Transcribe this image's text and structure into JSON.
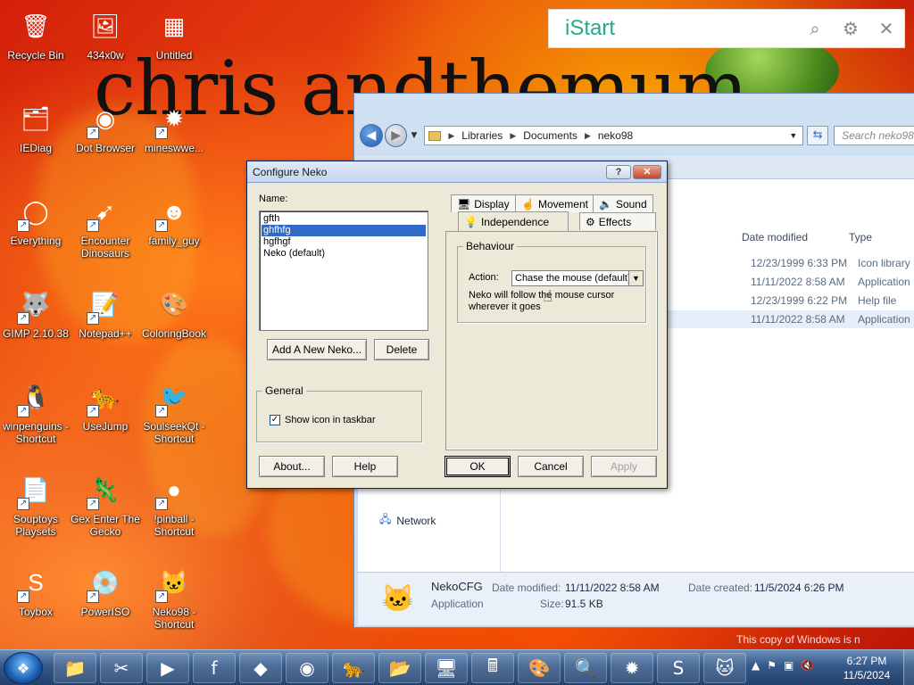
{
  "wallpaper": {
    "text": "chris andthemum"
  },
  "desktop": {
    "icons": [
      {
        "label": "Recycle Bin",
        "glyph": "🗑",
        "shortcut": false
      },
      {
        "label": "434x0w",
        "glyph": "🖼",
        "shortcut": false
      },
      {
        "label": "Untitled",
        "glyph": "▦",
        "shortcut": false
      },
      {
        "label": "IEDiag",
        "glyph": "🗂",
        "shortcut": false
      },
      {
        "label": "Dot Browser",
        "glyph": "◉",
        "shortcut": true
      },
      {
        "label": "mineswwe...",
        "glyph": "✹",
        "shortcut": true
      },
      {
        "label": "Everything",
        "glyph": "◯",
        "shortcut": true
      },
      {
        "label": "Encounter Dinosaurs",
        "glyph": "➹",
        "shortcut": true
      },
      {
        "label": "family_guy",
        "glyph": "☻",
        "shortcut": true
      },
      {
        "label": "GIMP 2.10.38",
        "glyph": "🐺",
        "shortcut": true
      },
      {
        "label": "Notepad++",
        "glyph": "📝",
        "shortcut": true
      },
      {
        "label": "ColoringBook",
        "glyph": "🎨",
        "shortcut": false
      },
      {
        "label": "winpenguins - Shortcut",
        "glyph": "🐧",
        "shortcut": true
      },
      {
        "label": "UseJump",
        "glyph": "🐆",
        "shortcut": true
      },
      {
        "label": "SoulseekQt - Shortcut",
        "glyph": "🐦",
        "shortcut": true
      },
      {
        "label": "Souptoys Playsets",
        "glyph": "📄",
        "shortcut": true
      },
      {
        "label": "Gex Enter The Gecko",
        "glyph": "🦎",
        "shortcut": true
      },
      {
        "label": "!pinball - Shortcut",
        "glyph": "●",
        "shortcut": true
      },
      {
        "label": "Toybox",
        "glyph": "S",
        "shortcut": true
      },
      {
        "label": "PowerISO",
        "glyph": "💿",
        "shortcut": true
      },
      {
        "label": "Neko98 - Shortcut",
        "glyph": "🐱",
        "shortcut": true
      }
    ]
  },
  "istart": {
    "brand": "iStart",
    "search_icon": "search-icon",
    "settings_icon": "gear-icon",
    "close_icon": "close-icon"
  },
  "explorer": {
    "breadcrumb": [
      "Libraries",
      "Documents",
      "neko98"
    ],
    "search_placeholder": "Search neko98",
    "columns": [
      "Date modified",
      "Type"
    ],
    "files": [
      {
        "date": "12/23/1999 6:33 PM",
        "type": "Icon library",
        "selected": false
      },
      {
        "date": "11/11/2022 8:58 AM",
        "type": "Application",
        "selected": false
      },
      {
        "date": "12/23/1999 6:22 PM",
        "type": "Help file",
        "selected": false
      },
      {
        "date": "11/11/2022 8:58 AM",
        "type": "Application",
        "selected": true
      }
    ],
    "network_label": "Network",
    "details": {
      "name": "NekoCFG",
      "type": "Application",
      "modified_label": "Date modified:",
      "modified_value": "11/11/2022 8:58 AM",
      "created_label": "Date created:",
      "created_value": "11/5/2024 6:26 PM",
      "size_label": "Size:",
      "size_value": "91.5 KB"
    }
  },
  "dialog": {
    "title": "Configure Neko",
    "help_button": "?",
    "close_button": "✕",
    "name_label": "Name:",
    "names": [
      "gfth",
      "ghfhfg",
      "hgfhgf",
      "Neko (default)"
    ],
    "selected_name": "ghfhfg",
    "add_button": "Add A New Neko...",
    "delete_button": "Delete",
    "general_group": "General",
    "show_icon_label": "Show icon in taskbar",
    "show_icon_checked": true,
    "about_button": "About...",
    "help_btn_label": "Help",
    "tabs_row1": [
      {
        "label": "Display",
        "icon": "display-icon",
        "glyph": "🖥"
      },
      {
        "label": "Movement",
        "icon": "hand-icon",
        "glyph": "☝"
      },
      {
        "label": "Sound",
        "icon": "speaker-icon",
        "glyph": "🔈"
      }
    ],
    "tabs_row2": [
      {
        "label": "Independence",
        "icon": "bulb-icon",
        "glyph": "💡",
        "active": true
      },
      {
        "label": "Effects",
        "icon": "effects-icon",
        "glyph": "⚙",
        "active": false
      }
    ],
    "behaviour_group": "Behaviour",
    "action_label": "Action:",
    "action_value": "Chase the mouse (default)",
    "description": "Neko will follow the mouse cursor wherever it goes",
    "ok_button": "OK",
    "cancel_button": "Cancel",
    "apply_button": "Apply"
  },
  "taskbar": {
    "clock_time": "6:27 PM",
    "clock_date": "11/5/2024",
    "watermark": "This copy of Windows is n",
    "pinned": [
      {
        "name": "explorer",
        "glyph": "📁"
      },
      {
        "name": "snipping-tool",
        "glyph": "✂"
      },
      {
        "name": "media-player",
        "glyph": "▶"
      },
      {
        "name": "facebook",
        "glyph": "f"
      },
      {
        "name": "game",
        "glyph": "◆"
      },
      {
        "name": "dot-browser",
        "glyph": "◉"
      },
      {
        "name": "usejump",
        "glyph": "🐆"
      },
      {
        "name": "folder",
        "glyph": "📂"
      },
      {
        "name": "computer",
        "glyph": "🖥"
      },
      {
        "name": "calculator",
        "glyph": "🖩"
      },
      {
        "name": "paint",
        "glyph": "🎨"
      },
      {
        "name": "search-app",
        "glyph": "🔍"
      },
      {
        "name": "minesweeper",
        "glyph": "✹"
      },
      {
        "name": "toybox",
        "glyph": "S"
      },
      {
        "name": "neko",
        "glyph": "🐱"
      }
    ]
  }
}
